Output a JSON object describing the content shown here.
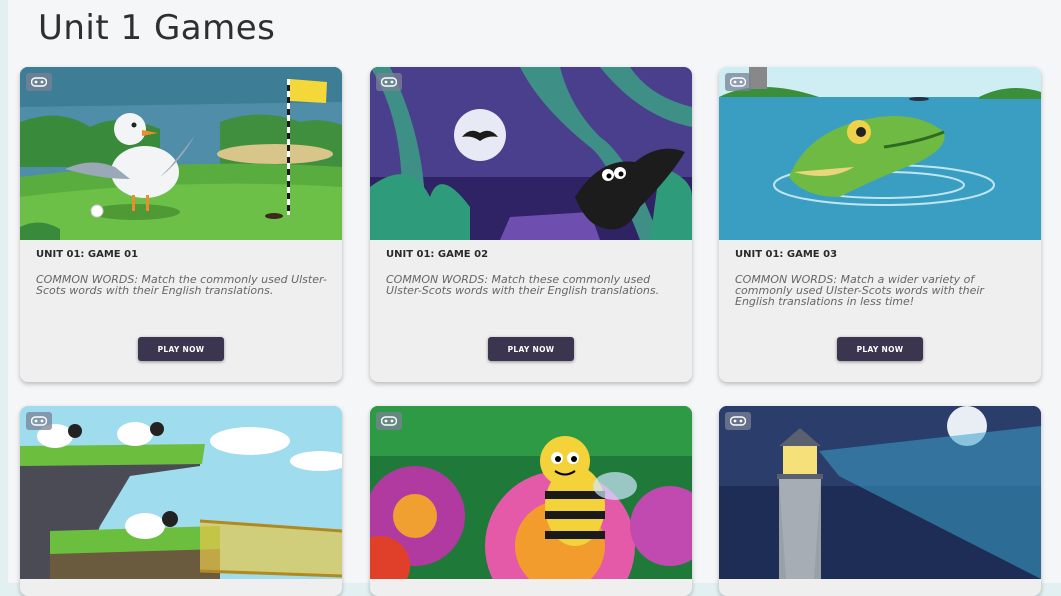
{
  "page": {
    "title": "Unit 1 Games"
  },
  "cards": [
    {
      "label": "UNIT 01: GAME 01",
      "description": "COMMON WORDS: Match the commonly used Ulster-Scots words with their English translations.",
      "button": "PLAY NOW",
      "badge_icon": "gamepad-icon"
    },
    {
      "label": "UNIT 01: GAME 02",
      "description": "COMMON WORDS: Match these commonly used Ulster-Scots words with their English translations.",
      "button": "PLAY NOW",
      "badge_icon": "gamepad-icon"
    },
    {
      "label": "UNIT 01: GAME 03",
      "description": "COMMON WORDS: Match a wider variety of commonly used Ulster-Scots words with their English translations in less time!",
      "button": "PLAY NOW",
      "badge_icon": "gamepad-icon"
    },
    {
      "badge_icon": "gamepad-icon"
    },
    {
      "badge_icon": "gamepad-icon"
    },
    {
      "badge_icon": "gamepad-icon"
    }
  ],
  "colors": {
    "page_background": "#e3f0f2",
    "panel_background": "#f5f6f8",
    "card_background": "#efefef",
    "button_background": "#3b3550",
    "button_text": "#ffffff"
  }
}
